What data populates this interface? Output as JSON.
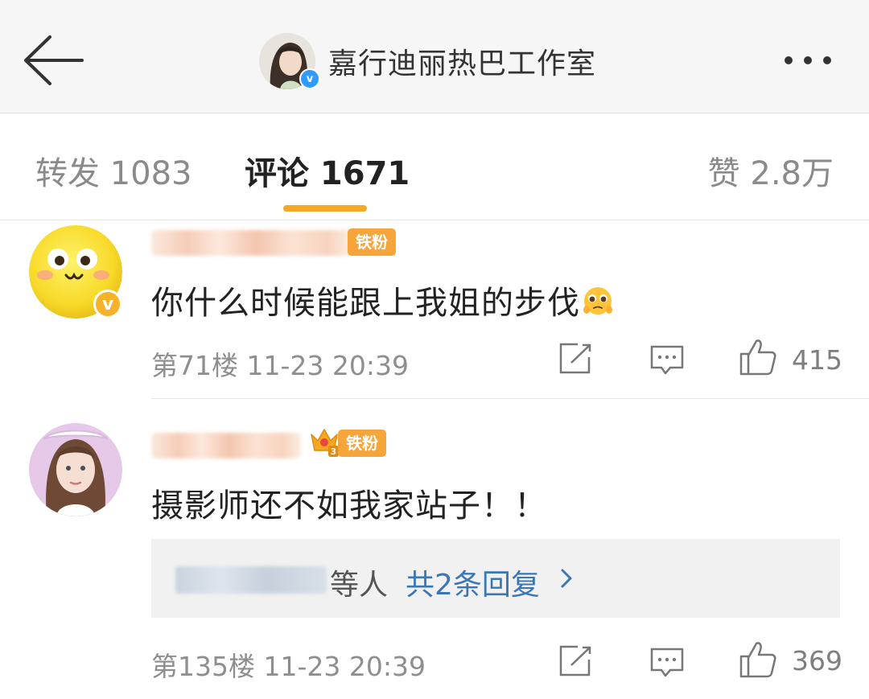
{
  "header": {
    "account_name": "嘉行迪丽热巴工作室",
    "verified_badge": "v",
    "icons": {
      "back": "back-arrow-icon",
      "more": "more-dots-icon"
    }
  },
  "tabs": [
    {
      "label": "转发 1083",
      "active": false
    },
    {
      "label": "评论 1671",
      "active": true
    },
    {
      "label": "赞 2.8万",
      "active": false
    }
  ],
  "comments": [
    {
      "fan_badge": "铁粉",
      "verified_badge": "v",
      "text": "你什么时候能跟上我姐的步伐",
      "emoji": "pleading-face-emoji",
      "floor": "第71楼",
      "time": "11-23 20:39",
      "likes": "415"
    },
    {
      "fan_badge": "铁粉",
      "fan_level": "3",
      "text": "摄影师还不如我家站子！！",
      "reply_suffix": "等人",
      "reply_link": "共2条回复",
      "floor": "第135楼",
      "time": "11-23 20:39",
      "likes": "369"
    }
  ],
  "colors": {
    "accent": "#f7a823",
    "link": "#3a77b6",
    "fan_badge": "#f6a53a",
    "verified_blue": "#2f9bff"
  }
}
